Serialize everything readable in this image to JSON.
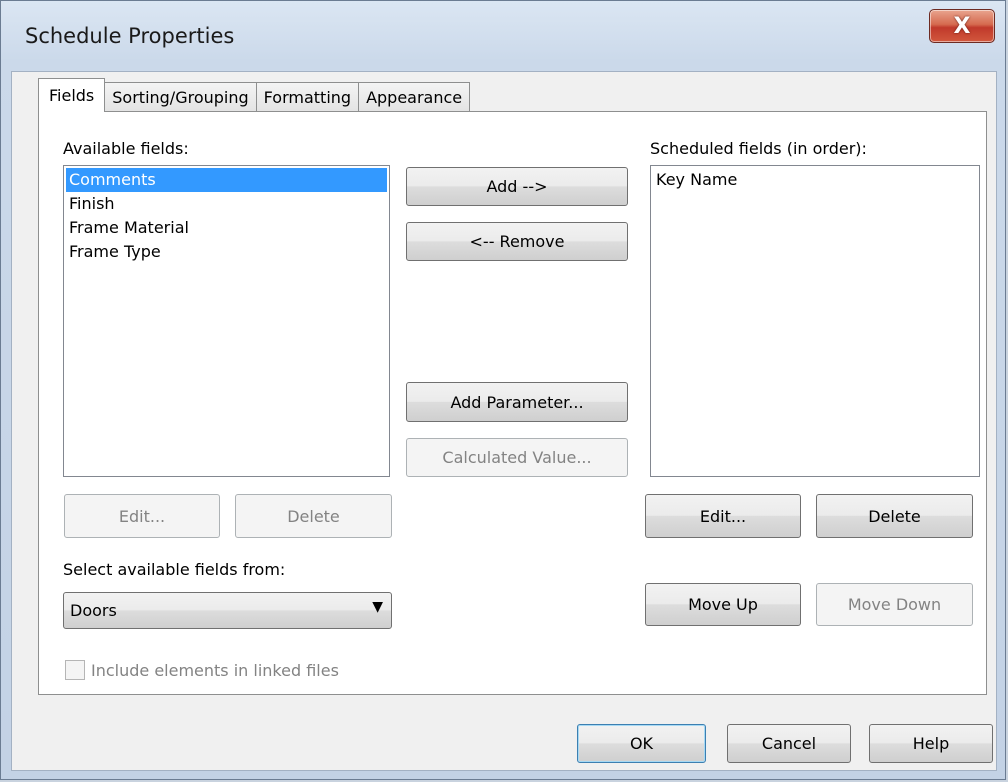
{
  "window": {
    "title": "Schedule Properties",
    "close_glyph": "X"
  },
  "tabs": [
    {
      "label": "Fields",
      "active": true
    },
    {
      "label": "Sorting/Grouping",
      "active": false
    },
    {
      "label": "Formatting",
      "active": false
    },
    {
      "label": "Appearance",
      "active": false
    }
  ],
  "available": {
    "label": "Available fields:",
    "items": [
      "Comments",
      "Finish",
      "Frame Material",
      "Frame Type"
    ],
    "selected": "Comments",
    "edit_label": "Edit...",
    "delete_label": "Delete"
  },
  "middle": {
    "add_label": "Add -->",
    "remove_label": "<-- Remove",
    "add_parameter_label": "Add Parameter...",
    "calculated_value_label": "Calculated Value..."
  },
  "scheduled": {
    "label": "Scheduled fields (in order):",
    "items": [
      "Key Name"
    ],
    "edit_label": "Edit...",
    "delete_label": "Delete",
    "move_up_label": "Move Up",
    "move_down_label": "Move Down"
  },
  "source": {
    "label": "Select available fields from:",
    "value": "Doors",
    "arrow_glyph": "▼"
  },
  "linked": {
    "label": "Include elements in linked files",
    "checked": false
  },
  "footer": {
    "ok_label": "OK",
    "cancel_label": "Cancel",
    "help_label": "Help"
  }
}
